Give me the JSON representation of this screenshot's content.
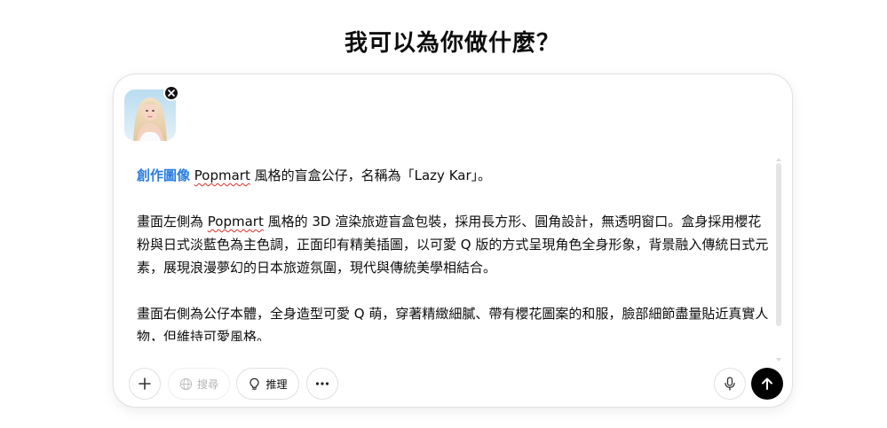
{
  "page": {
    "title": "我可以為你做什麼？"
  },
  "composer": {
    "attachment": {
      "kind": "image-thumbnail"
    },
    "prompt": {
      "mention": "創作圖像",
      "line1_word": "Popmart",
      "line1_rest": " 風格的盲盒公仔，名稱為「Lazy Kar」。",
      "p2_pre": "畫面左側為 ",
      "p2_word": "Popmart",
      "p2_rest": " 風格的 3D 渲染旅遊盲盒包裝，採用長方形、圓角設計，無透明窗口。盒身採用櫻花粉與日式淡藍色為主色調，正面印有精美插圖，以可愛 Q 版的方式呈現角色全身形象，背景融入傳統日式元素，展現浪漫夢幻的日本旅遊氛圍，現代與傳統美學相結合。",
      "p3": "畫面右側為公仔本體，全身造型可愛 Q 萌，穿著精緻細膩、帶有櫻花圖案的和服，臉部細節盡量貼近真實人物，但維持可愛風格。"
    },
    "toolbar": {
      "add_icon": "plus-icon",
      "search_label": "搜尋",
      "search_icon": "globe-icon",
      "reason_label": "推理",
      "reason_icon": "lightbulb-icon",
      "more_icon": "ellipsis-icon",
      "mic_icon": "microphone-icon",
      "send_icon": "arrow-up-icon"
    },
    "colors": {
      "mention": "#2a7de1",
      "send_button": "#000000"
    }
  }
}
